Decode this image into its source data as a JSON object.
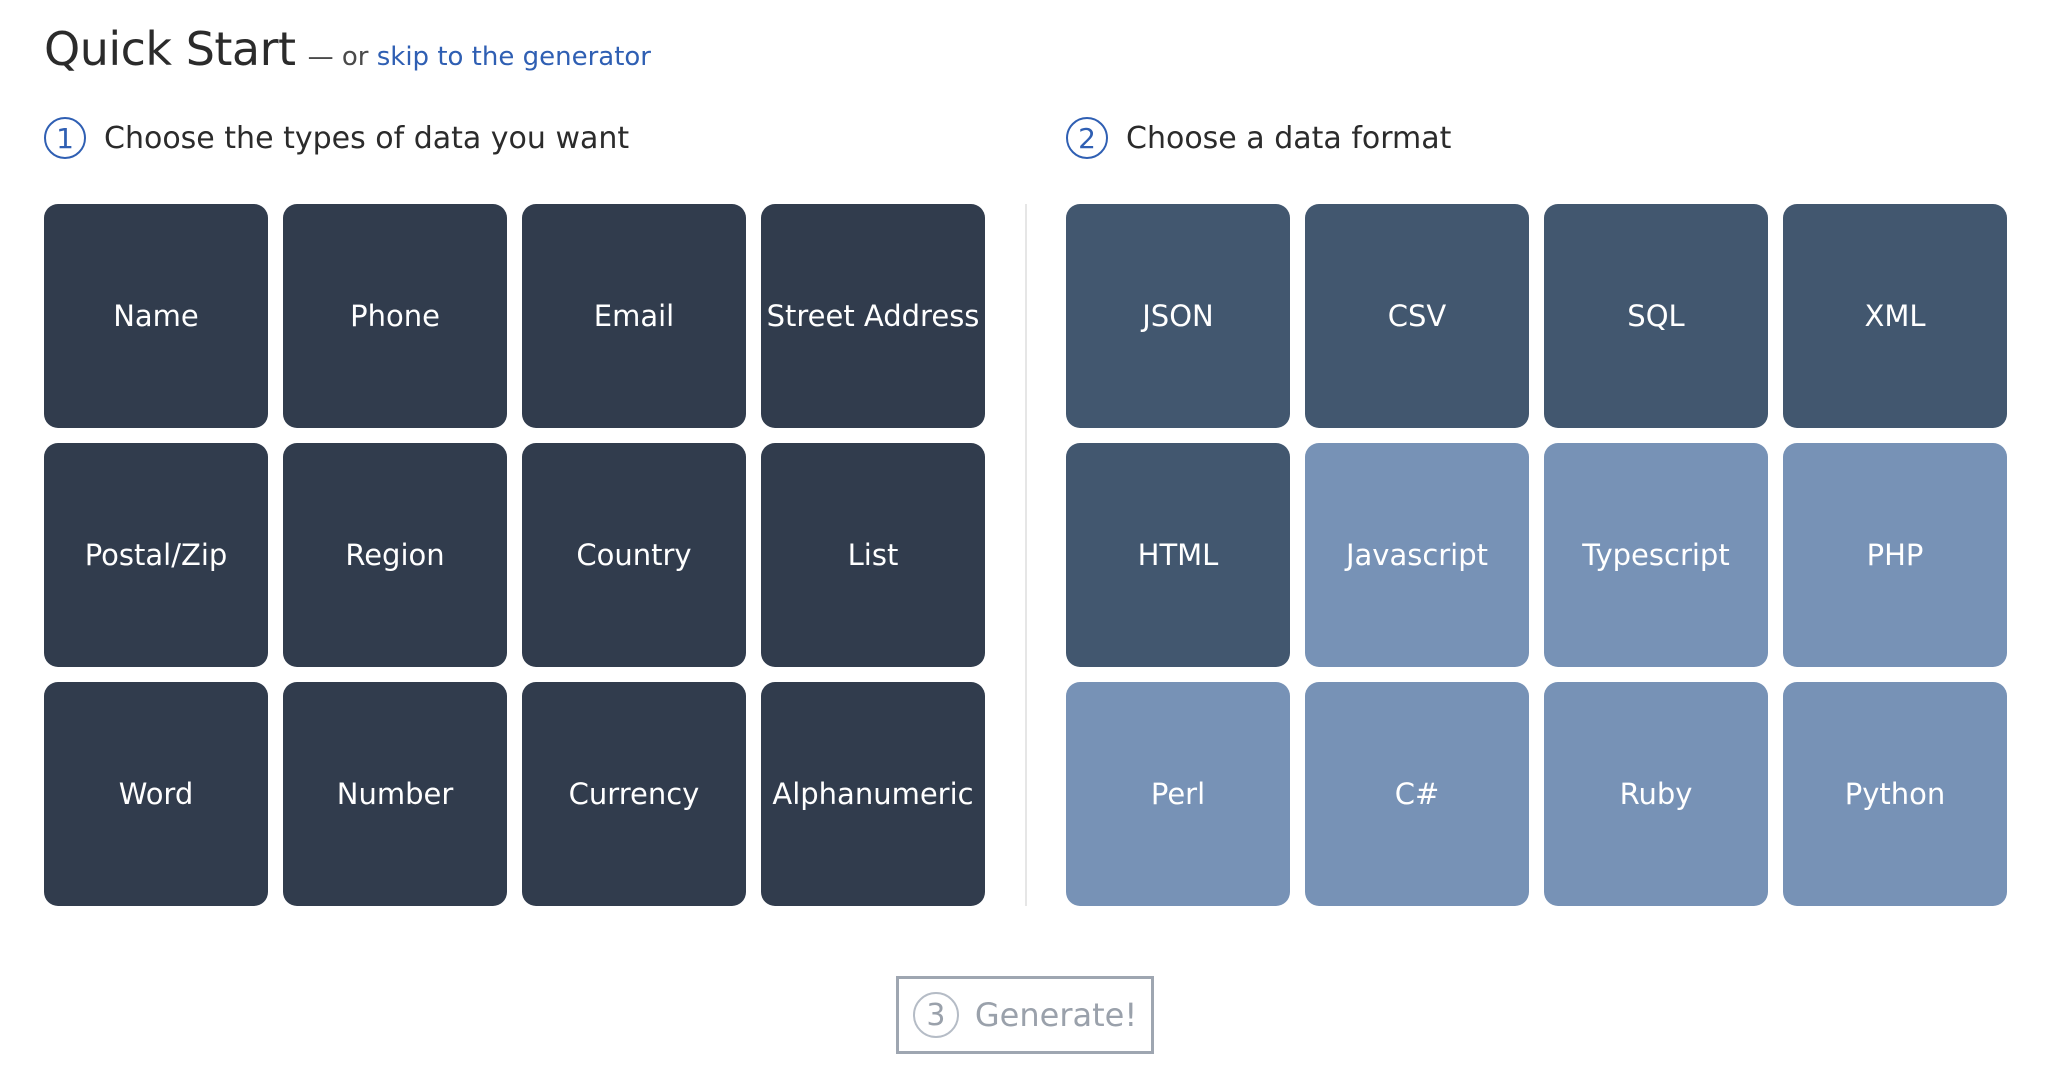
{
  "header": {
    "title": "Quick Start",
    "separator": "— or",
    "skip_link": "skip to the generator"
  },
  "step1": {
    "number": "1",
    "label": "Choose the types of data you want"
  },
  "step2": {
    "number": "2",
    "label": "Choose a data format"
  },
  "data_types": [
    {
      "label": "Name"
    },
    {
      "label": "Phone"
    },
    {
      "label": "Email"
    },
    {
      "label": "Street Address"
    },
    {
      "label": "Postal/Zip"
    },
    {
      "label": "Region"
    },
    {
      "label": "Country"
    },
    {
      "label": "List"
    },
    {
      "label": "Word"
    },
    {
      "label": "Number"
    },
    {
      "label": "Currency"
    },
    {
      "label": "Alphanumeric"
    }
  ],
  "data_formats": [
    {
      "label": "JSON",
      "emphasis": true
    },
    {
      "label": "CSV",
      "emphasis": true
    },
    {
      "label": "SQL",
      "emphasis": true
    },
    {
      "label": "XML",
      "emphasis": true
    },
    {
      "label": "HTML",
      "emphasis": true
    },
    {
      "label": "Javascript",
      "emphasis": false
    },
    {
      "label": "Typescript",
      "emphasis": false
    },
    {
      "label": "PHP",
      "emphasis": false
    },
    {
      "label": "Perl",
      "emphasis": false
    },
    {
      "label": "C#",
      "emphasis": false
    },
    {
      "label": "Ruby",
      "emphasis": false
    },
    {
      "label": "Python",
      "emphasis": false
    }
  ],
  "generate": {
    "number": "3",
    "label": "Generate!"
  },
  "colors": {
    "type_tile": "#313c4d",
    "format_tile_emphasis": "#42576f",
    "format_tile": "#7792b6",
    "accent": "#2f5fb3"
  }
}
